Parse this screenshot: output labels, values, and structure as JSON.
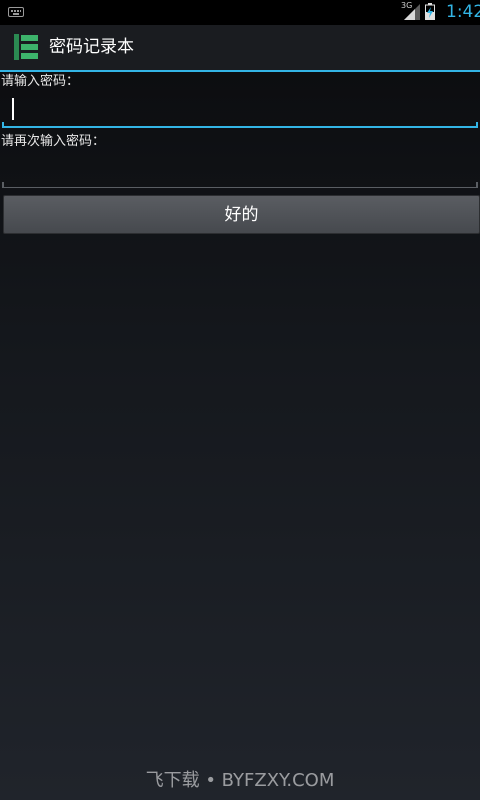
{
  "status_bar": {
    "network_type": "3G",
    "time": "1:42",
    "accent_color": "#33b5e5",
    "icons": [
      "keyboard-icon",
      "signal-icon",
      "battery-charging-icon"
    ]
  },
  "action_bar": {
    "title": "密码记录本",
    "icon": "app-list-icon",
    "icon_color": "#3db36b"
  },
  "form": {
    "password_label": "请输入密码：",
    "password_value": "",
    "confirm_label": "请再次输入密码：",
    "confirm_value": "",
    "ok_label": "好的"
  },
  "watermark": "飞下载 • BYFZXY.COM"
}
